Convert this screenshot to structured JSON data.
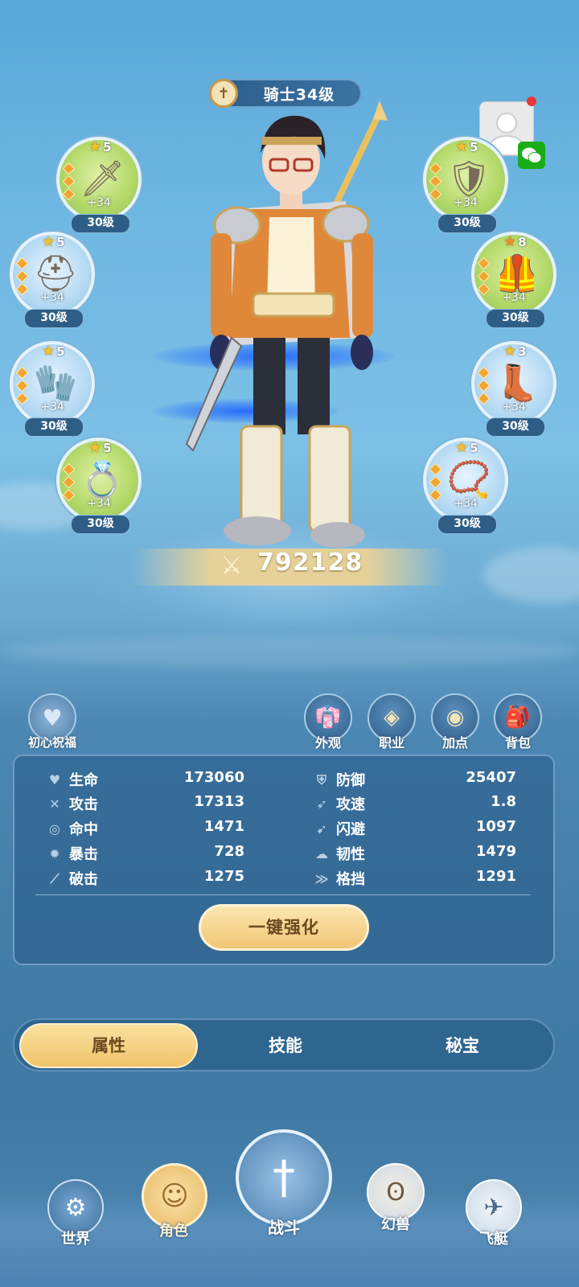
{
  "header": {
    "class_title": "骑士34级"
  },
  "equipment": {
    "left": [
      {
        "stars": "5",
        "plus": "+34",
        "level": "30级",
        "icon": "sword-icon"
      },
      {
        "stars": "5",
        "plus": "+34",
        "level": "30级",
        "icon": "helmet-icon"
      },
      {
        "stars": "5",
        "plus": "+34",
        "level": "30级",
        "icon": "gauntlet-icon"
      },
      {
        "stars": "5",
        "plus": "+34",
        "level": "30级",
        "icon": "ring-icon"
      }
    ],
    "right": [
      {
        "stars": "5",
        "plus": "+34",
        "level": "30级",
        "icon": "shield-icon"
      },
      {
        "stars": "8",
        "plus": "+34",
        "level": "30级",
        "icon": "armor-icon"
      },
      {
        "stars": "3",
        "plus": "+34",
        "level": "30级",
        "icon": "boots-icon"
      },
      {
        "stars": "5",
        "plus": "+34",
        "level": "30级",
        "icon": "necklace-icon"
      }
    ]
  },
  "power": {
    "value": "792128"
  },
  "quick_buttons": {
    "blessing": "初心祝福",
    "appearance": "外观",
    "profession": "职业",
    "points": "加点",
    "bag": "背包"
  },
  "stats": {
    "left": [
      {
        "name": "生命",
        "value": "173060",
        "icon": "heart-icon"
      },
      {
        "name": "攻击",
        "value": "17313",
        "icon": "crossed-swords-icon"
      },
      {
        "name": "命中",
        "value": "1471",
        "icon": "target-icon"
      },
      {
        "name": "暴击",
        "value": "728",
        "icon": "crit-icon"
      },
      {
        "name": "破击",
        "value": "1275",
        "icon": "pierce-icon"
      }
    ],
    "right": [
      {
        "name": "防御",
        "value": "25407",
        "icon": "defense-icon"
      },
      {
        "name": "攻速",
        "value": "1.8",
        "icon": "speed-icon"
      },
      {
        "name": "闪避",
        "value": "1097",
        "icon": "dodge-icon"
      },
      {
        "name": "韧性",
        "value": "1479",
        "icon": "toughness-icon"
      },
      {
        "name": "格挡",
        "value": "1291",
        "icon": "block-icon"
      }
    ]
  },
  "enhance_button": "一键强化",
  "tabs": [
    {
      "label": "属性",
      "active": true
    },
    {
      "label": "技能",
      "active": false
    },
    {
      "label": "秘宝",
      "active": false
    }
  ],
  "bottom_nav": {
    "world": "世界",
    "character": "角色",
    "battle": "战斗",
    "beast": "幻兽",
    "airship": "飞艇"
  }
}
